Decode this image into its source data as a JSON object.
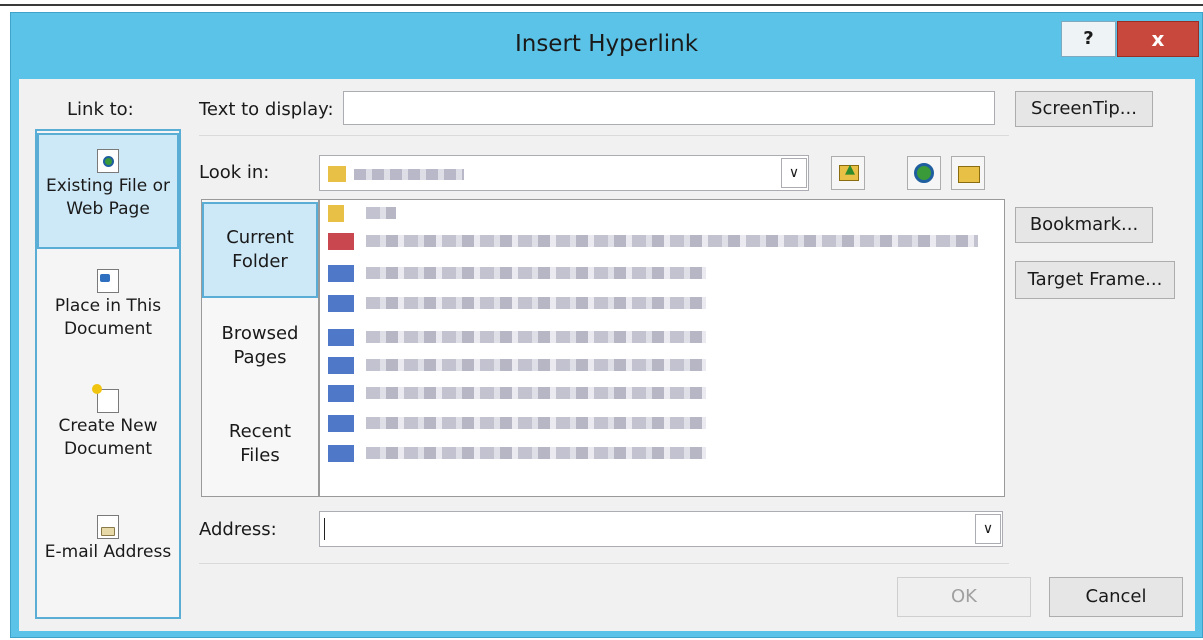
{
  "dialog": {
    "title": "Insert Hyperlink",
    "help_label": "?",
    "close_label": "x"
  },
  "link_to": {
    "label": "Link to:",
    "items": [
      {
        "line1": "Existing File or",
        "line2": "Web Page",
        "selected": true
      },
      {
        "line1": "Place in This",
        "line2": "Document",
        "selected": false
      },
      {
        "line1": "Create New",
        "line2": "Document",
        "selected": false
      },
      {
        "line1": "E-mail Address",
        "line2": "",
        "selected": false
      }
    ]
  },
  "text_to_display": {
    "label": "Text to display:",
    "value": ""
  },
  "look_in": {
    "label": "Look in:",
    "value": ""
  },
  "browse_tabs": [
    {
      "line1": "Current",
      "line2": "Folder",
      "selected": true
    },
    {
      "line1": "Browsed",
      "line2": "Pages",
      "selected": false
    },
    {
      "line1": "Recent",
      "line2": "Files",
      "selected": false
    }
  ],
  "file_list": {
    "rows": [
      {
        "icon": "folder-icon",
        "color": "#e8c045"
      },
      {
        "icon": "pdf-file-icon",
        "color": "#c9484f"
      },
      {
        "icon": "word-file-icon",
        "color": "#4f78c9"
      },
      {
        "icon": "word-file-icon",
        "color": "#4f78c9"
      },
      {
        "icon": "word-file-icon",
        "color": "#4f78c9"
      },
      {
        "icon": "word-file-icon",
        "color": "#4f78c9"
      },
      {
        "icon": "word-file-icon",
        "color": "#4f78c9"
      },
      {
        "icon": "word-file-icon",
        "color": "#4f78c9"
      },
      {
        "icon": "word-file-icon",
        "color": "#4f78c9"
      }
    ]
  },
  "address": {
    "label": "Address:",
    "value": ""
  },
  "buttons": {
    "screentip": "ScreenTip...",
    "bookmark": "Bookmark...",
    "target_frame": "Target Frame...",
    "ok": "OK",
    "cancel": "Cancel"
  },
  "colors": {
    "titlebar": "#5bc3e8",
    "close": "#c9483e",
    "selection": "#cde8f6",
    "selection_border": "#5aaed6"
  }
}
